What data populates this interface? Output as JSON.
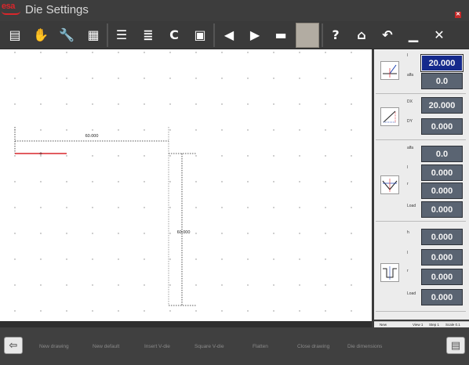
{
  "app": {
    "logo_text": "esa",
    "title": "Die Settings",
    "close_glyph": "✕"
  },
  "toolbar": {
    "buttons": [
      {
        "name": "document-icon",
        "glyph": "▤"
      },
      {
        "name": "hand-icon",
        "glyph": "✋"
      },
      {
        "name": "wrench-icon",
        "glyph": "🔧"
      },
      {
        "name": "calendar-grid-icon",
        "glyph": "▦"
      },
      {
        "name": "layers-list-icon",
        "glyph": "☰"
      },
      {
        "name": "database-list-icon",
        "glyph": "≣"
      },
      {
        "name": "letter-c-icon",
        "glyph": "C"
      },
      {
        "name": "save-disk-icon",
        "glyph": "▣"
      },
      {
        "name": "arrow-left-icon",
        "glyph": "◀"
      },
      {
        "name": "arrow-right-icon",
        "glyph": "▶"
      },
      {
        "name": "card-icon",
        "glyph": "▬"
      },
      {
        "name": "blank-slot",
        "glyph": ""
      },
      {
        "name": "help-icon",
        "glyph": "?"
      },
      {
        "name": "home-icon",
        "glyph": "⌂"
      },
      {
        "name": "undo-icon",
        "glyph": "↶"
      },
      {
        "name": "minimize-icon",
        "glyph": "▁"
      },
      {
        "name": "close-icon",
        "glyph": "✕"
      }
    ]
  },
  "drawing": {
    "dimension_horizontal": "60.000",
    "dimension_vertical": "60.000"
  },
  "panel": {
    "section1": {
      "label_top": "l",
      "label_bottom": "alfa",
      "value_top": "20.000",
      "value_bottom": "0.0"
    },
    "section2": {
      "label_top": "DX",
      "label_bottom": "DY",
      "value_top": "20.000",
      "value_bottom": "0.000"
    },
    "section3": {
      "labels": [
        "alfa",
        "l",
        "r",
        "Load"
      ],
      "values": [
        "0.0",
        "0.000",
        "0.000",
        "0.000"
      ]
    },
    "section4": {
      "labels": [
        "h",
        "l",
        "r",
        "Load"
      ],
      "values": [
        "0.000",
        "0.000",
        "0.000",
        "0.000"
      ]
    }
  },
  "status": {
    "mode": "New",
    "view": "View 1",
    "step": "Step 1",
    "scale": "Scale 0.1"
  },
  "bottom": {
    "back_glyph": "⇦",
    "menu_glyph": "▤",
    "items": [
      "New drawing",
      "New default",
      "Insert V-die",
      "Square V-die",
      "Flatten",
      "Close drawing",
      "Die dimensions"
    ]
  },
  "colors": {
    "accent_red": "#d9262b",
    "value_box": "#5a6472",
    "active_value_box": "#152a8c"
  }
}
